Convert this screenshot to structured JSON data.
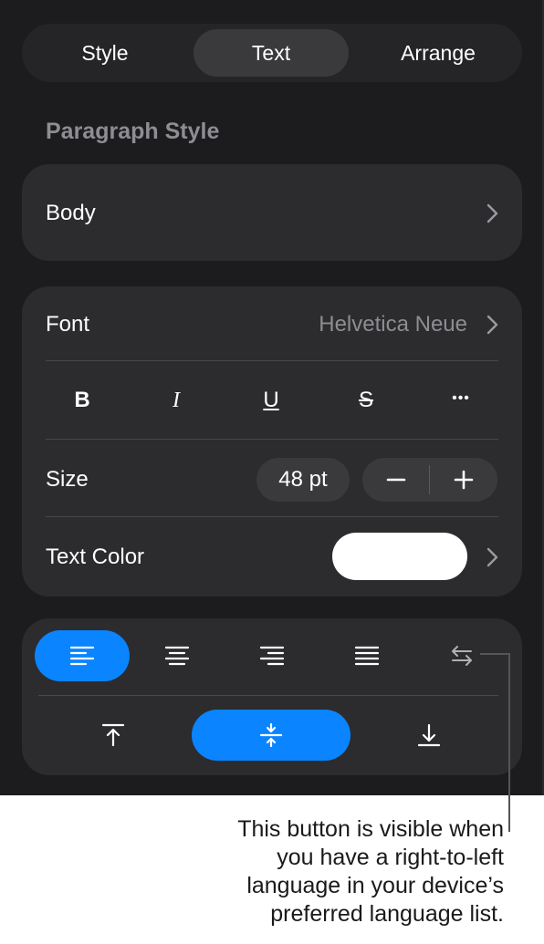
{
  "tabs": [
    {
      "label": "Style",
      "active": false
    },
    {
      "label": "Text",
      "active": true
    },
    {
      "label": "Arrange",
      "active": false
    }
  ],
  "paragraph_style": {
    "section_label": "Paragraph Style",
    "value": "Body"
  },
  "font": {
    "label": "Font",
    "value": "Helvetica Neue"
  },
  "format_buttons": [
    {
      "label": "B",
      "name": "bold"
    },
    {
      "label": "I",
      "name": "italic"
    },
    {
      "label": "U",
      "name": "underline"
    },
    {
      "label": "S",
      "name": "strikethrough"
    },
    {
      "label": "•••",
      "name": "more"
    }
  ],
  "size": {
    "label": "Size",
    "value": "48 pt"
  },
  "text_color": {
    "label": "Text Color",
    "swatch_color": "#ffffff"
  },
  "alignment": {
    "selected": "left",
    "options": [
      "left",
      "center",
      "right",
      "justify",
      "rtl"
    ]
  },
  "vertical_alignment": {
    "selected": "middle",
    "options": [
      "top",
      "middle",
      "bottom"
    ]
  },
  "colors": {
    "accent": "#0a84ff",
    "panel": "#1c1c1e",
    "card": "#2c2c2e"
  },
  "callout": {
    "lines": [
      "This button is visible when",
      "you have a right-to-left",
      "language in your device’s",
      "preferred language list."
    ]
  }
}
